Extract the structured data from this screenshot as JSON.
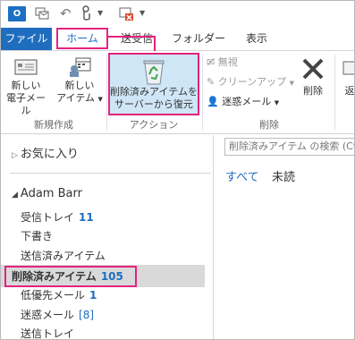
{
  "qat": {
    "app_logo": "O",
    "icons": [
      "outlook-logo-icon",
      "send-receive-icon",
      "undo-icon",
      "touch-mode-icon",
      "delete-all-icon",
      "customize-caret-icon"
    ]
  },
  "tabs": [
    {
      "label": "ファイル"
    },
    {
      "label": "ホーム"
    },
    {
      "label": "送受信"
    },
    {
      "label": "フォルダー"
    },
    {
      "label": "表示"
    }
  ],
  "ribbon": {
    "new_mail_line1": "新しい",
    "new_mail_line2": "電子メール",
    "new_items_line1": "新しい",
    "new_items_line2": "アイテム",
    "group_new": "新規作成",
    "recover_line1": "削除済みアイテムを",
    "recover_line2": "サーバーから復元",
    "group_actions": "アクション",
    "ignore": "無視",
    "cleanup": "クリーンアップ",
    "junk": "迷惑メール",
    "delete": "削除",
    "group_delete": "削除",
    "reply": "返"
  },
  "folders": {
    "favorites": "お気に入り",
    "account": "Adam Barr",
    "items": [
      {
        "label": "受信トレイ",
        "count": "11"
      },
      {
        "label": "下書き",
        "count": ""
      },
      {
        "label": "送信済みアイテム",
        "count": ""
      },
      {
        "label": "削除済みアイテム",
        "count": "105"
      },
      {
        "label": "低優先メール",
        "count": "1"
      },
      {
        "label": "迷惑メール",
        "count": "[8]"
      },
      {
        "label": "送信トレイ",
        "count": ""
      }
    ]
  },
  "message_list": {
    "search_placeholder": "削除済みアイテム の検索 (Ct",
    "filter_all": "すべて",
    "filter_unread": "未読"
  },
  "colors": {
    "accent": "#1e6dbf",
    "highlight": "#e3247c",
    "selected_bg": "#d9d9d9"
  }
}
